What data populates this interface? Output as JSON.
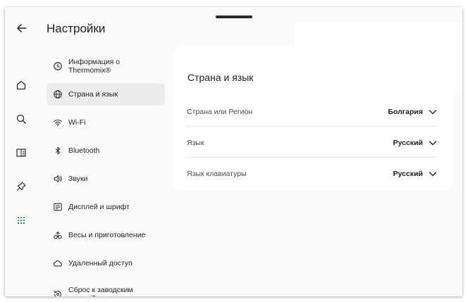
{
  "header": {
    "title": "Настройки"
  },
  "rail": {
    "items": [
      {
        "name": "home",
        "icon": "home-icon"
      },
      {
        "name": "search",
        "icon": "search-icon"
      },
      {
        "name": "recipes",
        "icon": "book-icon"
      },
      {
        "name": "favorites",
        "icon": "pin-icon"
      },
      {
        "name": "more",
        "icon": "grid-icon",
        "active": true
      }
    ],
    "accent": "#2e9e4f"
  },
  "menu": {
    "items": [
      {
        "label": "Информация о Thermomix®",
        "icon": "clock-icon"
      },
      {
        "label": "Страна и язык",
        "icon": "globe-icon",
        "active": true
      },
      {
        "label": "Wi-Fi",
        "icon": "wifi-icon"
      },
      {
        "label": "Bluetooth",
        "icon": "bluetooth-icon"
      },
      {
        "label": "Звуки",
        "icon": "speaker-icon"
      },
      {
        "label": "Дисплей и шрифт",
        "icon": "display-icon"
      },
      {
        "label": "Весы и приготовление",
        "icon": "scale-icon"
      },
      {
        "label": "Удаленный доступ",
        "icon": "cloud-icon"
      },
      {
        "label": "Сброс к заводским настройкам",
        "icon": "reset-icon"
      }
    ]
  },
  "content": {
    "title": "Страна и язык",
    "rows": [
      {
        "label": "Страна или Регион",
        "value": "Болгария"
      },
      {
        "label": "Язык",
        "value": "Русский"
      },
      {
        "label": "Язык клавиатуры",
        "value": "Русский"
      }
    ]
  }
}
